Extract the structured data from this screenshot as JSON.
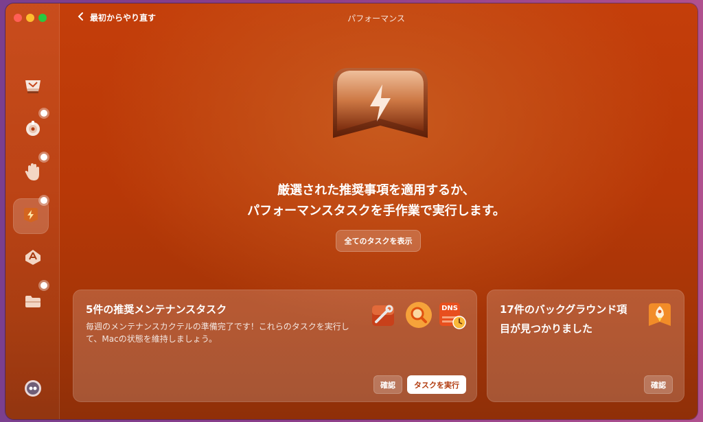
{
  "window": {
    "title": "パフォーマンス",
    "back_label": "最初からやり直す"
  },
  "sidebar": {
    "items": [
      {
        "icon": "cleanup-icon",
        "badge": false
      },
      {
        "icon": "protection-icon",
        "badge": true
      },
      {
        "icon": "privacy-hand-icon",
        "badge": true
      },
      {
        "icon": "performance-bolt-icon",
        "badge": true,
        "active": true
      },
      {
        "icon": "applications-icon",
        "badge": false
      },
      {
        "icon": "files-folder-icon",
        "badge": true
      }
    ],
    "bottom_icon": "assistant-icon"
  },
  "main": {
    "hero_icon": "performance-hero-icon",
    "headline_line1": "厳選された推奨事項を適用するか、",
    "headline_line2": "パフォーマンスタスクを手作業で実行します。",
    "show_all_label": "全てのタスクを表示"
  },
  "cards": {
    "maintenance": {
      "title": "5件の推奨メンテナンスタスク",
      "description_line1": "毎週のメンテナンスカクテルの準備完了です！これらのタスクを実行し",
      "description_line2": "て、Macの状態を維持しましょう。",
      "icons": [
        "disk-repair-icon",
        "spotlight-search-icon",
        "dns-flush-icon"
      ],
      "dns_label": "DNS",
      "review_label": "確認",
      "run_label": "タスクを実行"
    },
    "background": {
      "title_line1": "17件のバックグラウンド項",
      "title_line2": "目が見つかりました",
      "icon": "launch-agents-rocket-icon",
      "review_label": "確認"
    }
  },
  "colors": {
    "accent": "#c43e0a",
    "run_button_text": "#b23b0e"
  }
}
